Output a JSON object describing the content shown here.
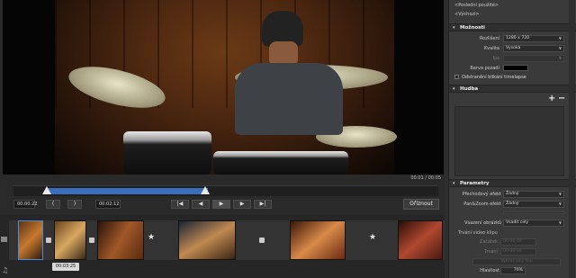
{
  "player": {
    "time_readout": "00:01 / 00:05"
  },
  "controls": {
    "start_time": "00:00:22",
    "open_bracket": "(",
    "close_bracket": ")",
    "end_time": "00:02:12",
    "btn_first": "|◀",
    "btn_prev": "◀",
    "btn_play": "▶",
    "btn_next": "▶",
    "btn_last": "▶|",
    "trim_label": "Oříznout"
  },
  "timeline": {
    "clip_time": "00:03:25",
    "music_icon": "music-note-icon"
  },
  "panel": {
    "recent_link": "<Poslední použité>",
    "default_link": "<Výchozí>",
    "options_title": "Možnosti",
    "resolution_label": "Rozlišení",
    "resolution_value": "1280 x 720",
    "quality_label": "Kvalita",
    "quality_value": "Vysoká",
    "fps_label": "fps",
    "bg_color_label": "Barva pozadí",
    "flicker_label": "Odstranění blikání timelapse",
    "music_title": "Hudba",
    "music_add": "+",
    "music_remove": "−",
    "params_title": "Parametry",
    "transition_label": "Přechodový efekt",
    "transition_value": "Žádný",
    "panzoom_label": "Pan&Zoom efekt",
    "panzoom_value": "Žádný",
    "insert_label": "Vsazení obrázků",
    "insert_value": "Vsadit celý",
    "clip_duration_label": "Trvání video klipu",
    "start_label": "Začátek",
    "start_value": "00:00:00",
    "length_label": "Trvání",
    "length_value": "00:00:00",
    "hidden_btn": "Vybrat celý klip",
    "volume_label": "Hlasitost",
    "volume_value": "70%"
  },
  "colors": {
    "accent": "#3b6db8",
    "bg_color_swatch": "#000000"
  }
}
